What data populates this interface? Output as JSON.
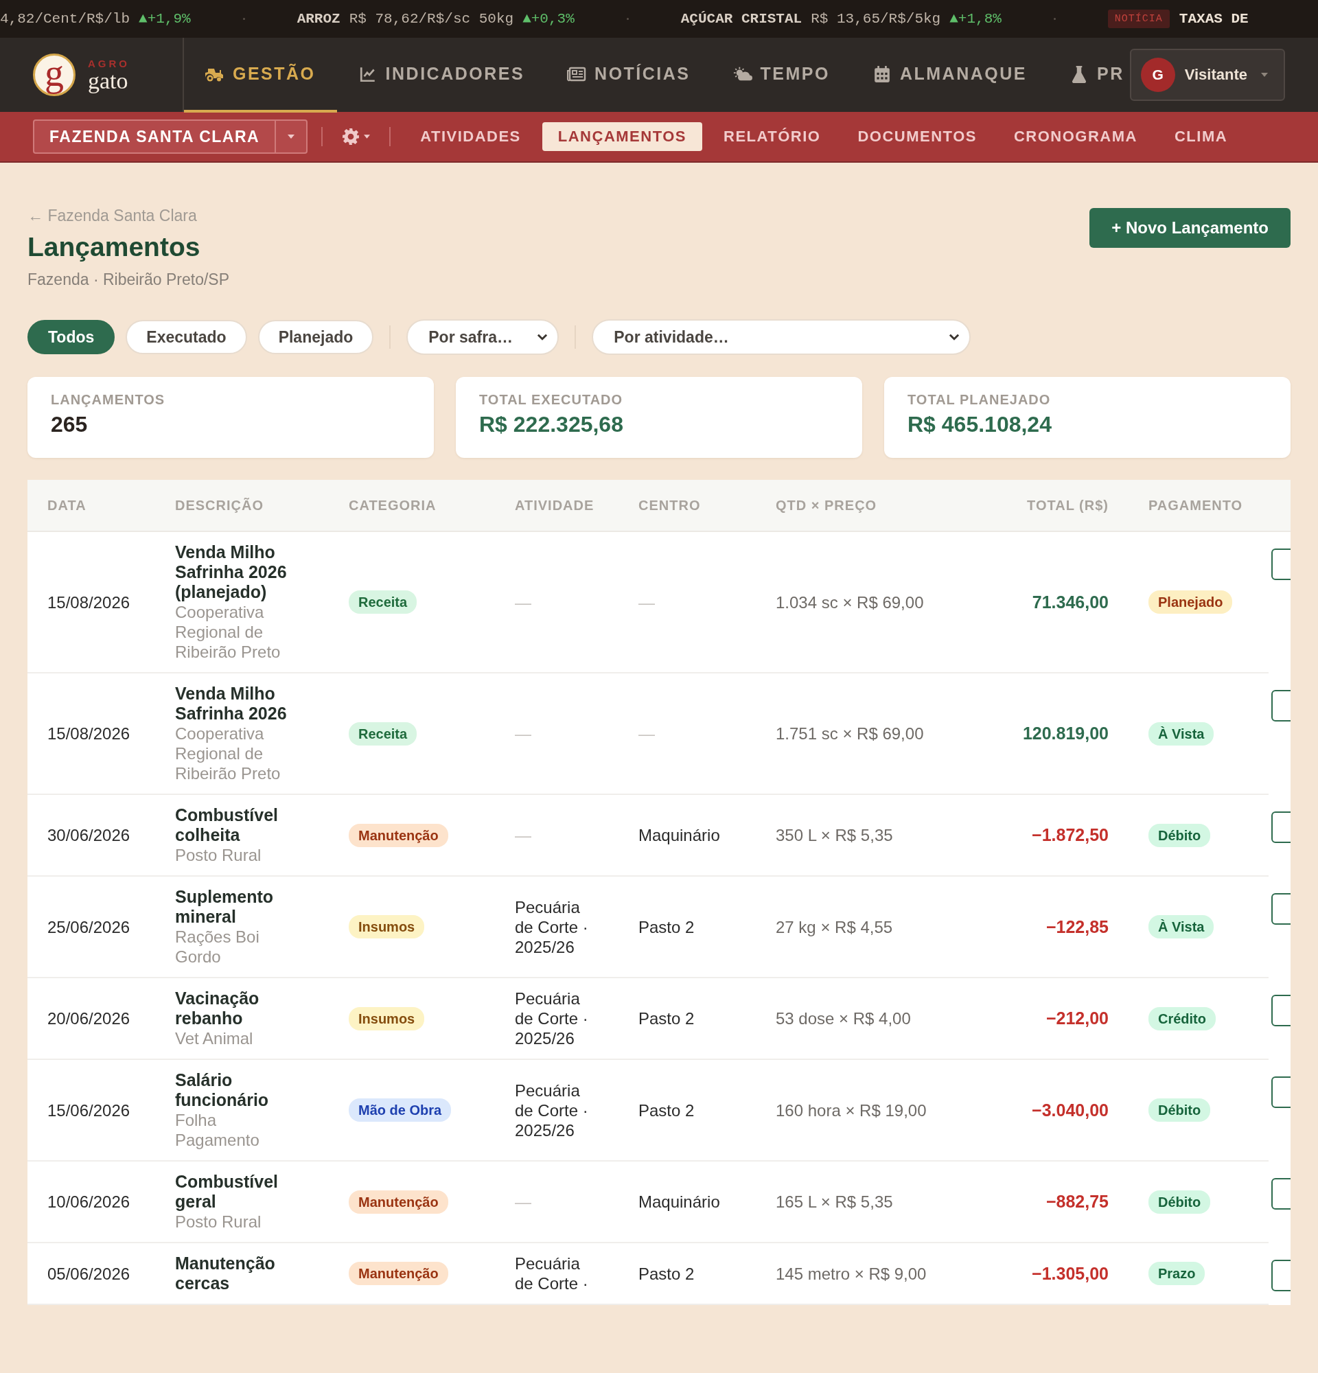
{
  "ticker": {
    "items": [
      {
        "price": "4,82/Cent/R$/lb",
        "change": "▲+1,9%"
      },
      {
        "name": "ARROZ",
        "price": "R$ 78,62/R$/sc 50kg",
        "change": "▲+0,3%"
      },
      {
        "name": "AÇÚCAR CRISTAL",
        "price": "R$ 13,65/R$/5kg",
        "change": "▲+1,8%"
      }
    ],
    "news_badge": "NOTÍCIA",
    "news_text": "TAXAS DE"
  },
  "logo": {
    "letter": "g",
    "tag": "AGRO",
    "name": "gato"
  },
  "nav": [
    {
      "label": "GESTÃO",
      "selected": true
    },
    {
      "label": "INDICADORES",
      "selected": false
    },
    {
      "label": "NOTÍCIAS",
      "selected": false
    },
    {
      "label": "TEMPO",
      "selected": false
    },
    {
      "label": "ALMANAQUE",
      "selected": false
    },
    {
      "label": "PR",
      "selected": false
    }
  ],
  "user": {
    "initial": "G",
    "name": "Visitante"
  },
  "farm_select": {
    "value": "FAZENDA SANTA CLARA"
  },
  "subnav": [
    {
      "label": "ATIVIDADES",
      "selected": false
    },
    {
      "label": "LANÇAMENTOS",
      "selected": true
    },
    {
      "label": "RELATÓRIO",
      "selected": false
    },
    {
      "label": "DOCUMENTOS",
      "selected": false
    },
    {
      "label": "CRONOGRAMA",
      "selected": false
    },
    {
      "label": "CLIMA",
      "selected": false
    }
  ],
  "breadcrumb": "← Fazenda Santa Clara",
  "title": "Lançamentos",
  "subtitle": "Fazenda · Ribeirão Preto/SP",
  "new_button": "+ Novo Lançamento",
  "filters": [
    {
      "label": "Todos",
      "selected": true
    },
    {
      "label": "Executado",
      "selected": false
    },
    {
      "label": "Planejado",
      "selected": false
    }
  ],
  "selects": [
    {
      "placeholder": "Por safra…",
      "kind": "short"
    },
    {
      "placeholder": "Por atividade…",
      "kind": "wide"
    }
  ],
  "stats": [
    {
      "label": "LANÇAMENTOS",
      "value": "265",
      "kind": "count"
    },
    {
      "label": "TOTAL EXECUTADO",
      "value": "R$ 222.325,68",
      "kind": "money"
    },
    {
      "label": "TOTAL PLANEJADO",
      "value": "R$ 465.108,24",
      "kind": "money"
    }
  ],
  "table": {
    "columns": [
      "DATA",
      "DESCRIÇÃO",
      "CATEGORIA",
      "ATIVIDADE",
      "CENTRO",
      "QTD × PREÇO",
      "TOTAL (R$)",
      "PAGAMENTO"
    ],
    "rows": [
      {
        "date": "15/08/2026",
        "description": "Venda Milho Safrinha 2026 (planejado)",
        "supplier": "Cooperativa Regional de Ribeirão Preto",
        "category": {
          "label": "Receita",
          "kind": "income"
        },
        "activity": "—",
        "center": "—",
        "qty": "1.034 sc × R$ 69,00",
        "total": {
          "value": "71.346,00",
          "kind": "income"
        },
        "payment": {
          "label": "Planejado",
          "kind": "planned"
        }
      },
      {
        "date": "15/08/2026",
        "description": "Venda Milho Safrinha 2026",
        "supplier": "Cooperativa Regional de Ribeirão Preto",
        "category": {
          "label": "Receita",
          "kind": "income"
        },
        "activity": "—",
        "center": "—",
        "qty": "1.751 sc × R$ 69,00",
        "total": {
          "value": "120.819,00",
          "kind": "income"
        },
        "payment": {
          "label": "À Vista",
          "kind": "done"
        }
      },
      {
        "date": "30/06/2026",
        "description": "Combustível colheita",
        "supplier": "Posto Rural",
        "category": {
          "label": "Manutenção",
          "kind": "maintenance"
        },
        "activity": "—",
        "center": "Maquinário",
        "qty": "350 L × R$ 5,35",
        "total": {
          "value": "−1.872,50",
          "kind": "expense"
        },
        "payment": {
          "label": "Débito",
          "kind": "done"
        }
      },
      {
        "date": "25/06/2026",
        "description": "Suplemento mineral",
        "supplier": "Rações Boi Gordo",
        "category": {
          "label": "Insumos",
          "kind": "inputs"
        },
        "activity": "Pecuária de Corte · 2025/26",
        "center": "Pasto 2",
        "qty": "27 kg × R$ 4,55",
        "total": {
          "value": "−122,85",
          "kind": "expense"
        },
        "payment": {
          "label": "À Vista",
          "kind": "done"
        }
      },
      {
        "date": "20/06/2026",
        "description": "Vacinação rebanho",
        "supplier": "Vet Animal",
        "category": {
          "label": "Insumos",
          "kind": "inputs"
        },
        "activity": "Pecuária de Corte · 2025/26",
        "center": "Pasto 2",
        "qty": "53 dose × R$ 4,00",
        "total": {
          "value": "−212,00",
          "kind": "expense"
        },
        "payment": {
          "label": "Crédito",
          "kind": "done"
        }
      },
      {
        "date": "15/06/2026",
        "description": "Salário funcionário",
        "supplier": "Folha Pagamento",
        "category": {
          "label": "Mão de Obra",
          "kind": "labor"
        },
        "activity": "Pecuária de Corte · 2025/26",
        "center": "Pasto 2",
        "qty": "160 hora × R$ 19,00",
        "total": {
          "value": "−3.040,00",
          "kind": "expense"
        },
        "payment": {
          "label": "Débito",
          "kind": "done"
        }
      },
      {
        "date": "10/06/2026",
        "description": "Combustível geral",
        "supplier": "Posto Rural",
        "category": {
          "label": "Manutenção",
          "kind": "maintenance"
        },
        "activity": "—",
        "center": "Maquinário",
        "qty": "165 L × R$ 5,35",
        "total": {
          "value": "−882,75",
          "kind": "expense"
        },
        "payment": {
          "label": "Débito",
          "kind": "done"
        }
      },
      {
        "date": "05/06/2026",
        "description": "Manutenção cercas",
        "category": {
          "label": "Manutenção",
          "kind": "maintenance"
        },
        "activity": "Pecuária de Corte ·",
        "center": "Pasto 2",
        "qty": "145 metro × R$ 9,00",
        "total": {
          "value": "−1.305,00",
          "kind": "expense"
        },
        "payment": {
          "label": "Prazo",
          "kind": "done"
        }
      }
    ]
  }
}
